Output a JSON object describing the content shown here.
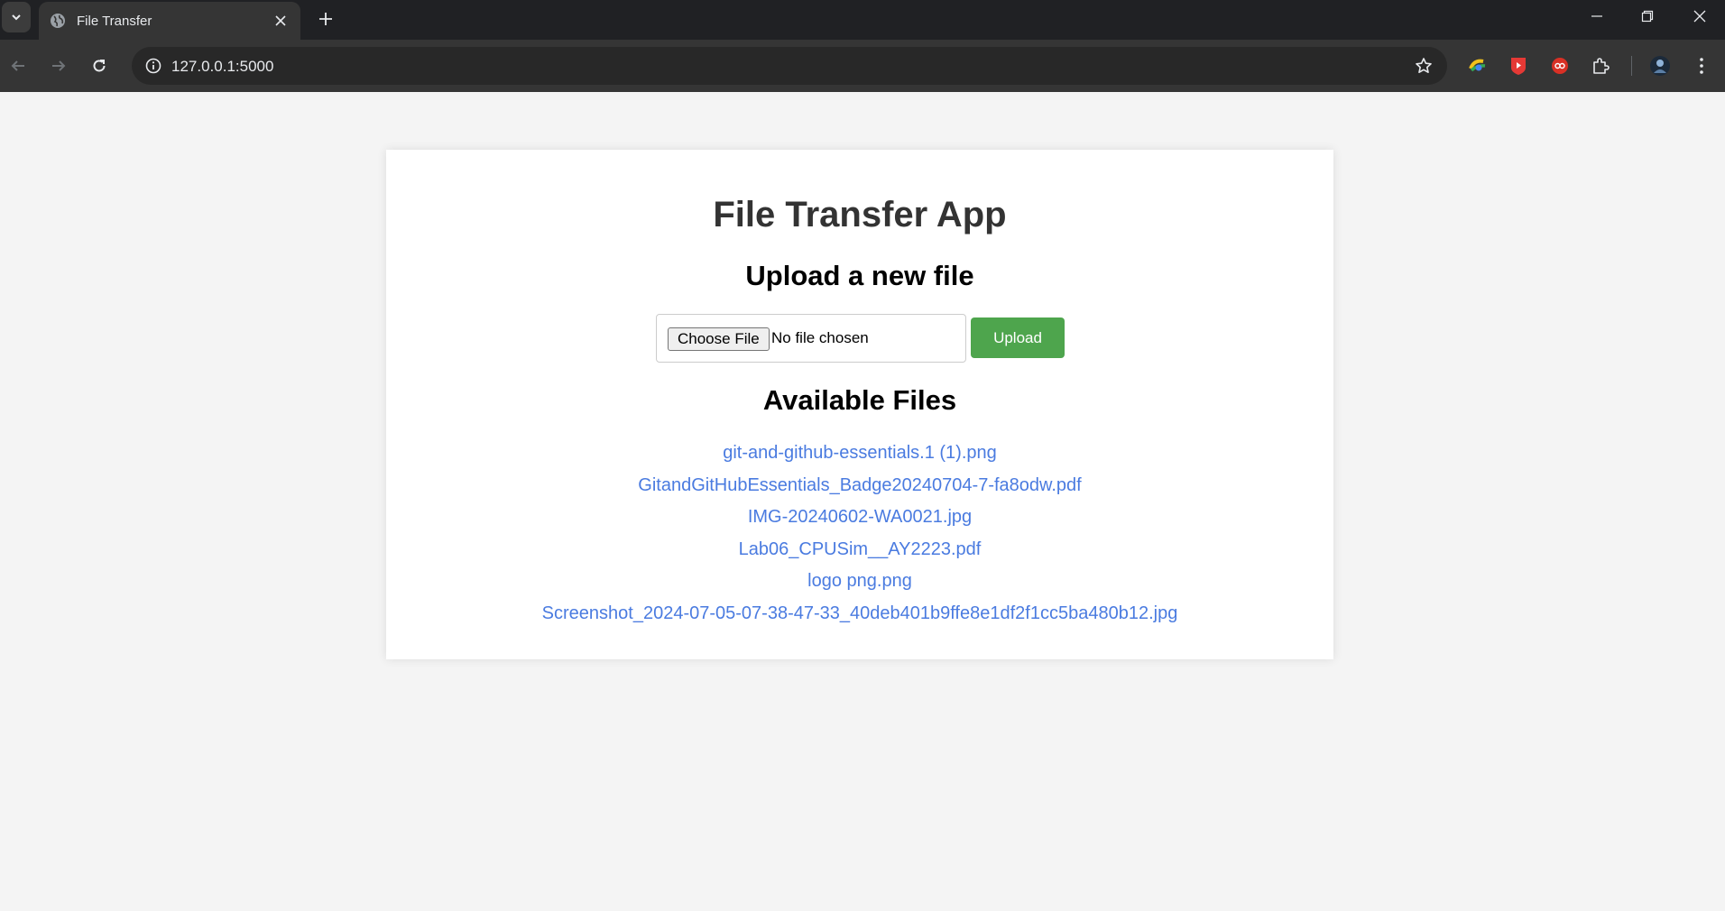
{
  "browser": {
    "tab_title": "File Transfer",
    "url": "127.0.0.1:5000",
    "icons": {
      "tab_search": "chevron-down-icon",
      "favicon": "globe-icon",
      "tab_close": "close-icon",
      "new_tab": "plus-icon",
      "back": "arrow-left-icon",
      "forward": "arrow-right-icon",
      "reload": "reload-icon",
      "site_info": "info-icon",
      "bookmark": "star-icon",
      "extensions": "puzzle-icon",
      "menu": "kebab-menu-icon"
    }
  },
  "page": {
    "title": "File Transfer App",
    "upload_heading": "Upload a new file",
    "choose_file_label": "Choose File",
    "no_file_text": "No file chosen",
    "upload_button": "Upload",
    "files_heading": "Available Files",
    "files": [
      "git-and-github-essentials.1 (1).png",
      "GitandGitHubEssentials_Badge20240704-7-fa8odw.pdf",
      "IMG-20240602-WA0021.jpg",
      "Lab06_CPUSim__AY2223.pdf",
      "logo png.png",
      "Screenshot_2024-07-05-07-38-47-33_40deb401b9ffe8e1df2f1cc5ba480b12.jpg"
    ]
  },
  "colors": {
    "accent_green": "#4ea54d",
    "link_blue": "#4a7be0",
    "page_bg": "#f4f4f4"
  }
}
